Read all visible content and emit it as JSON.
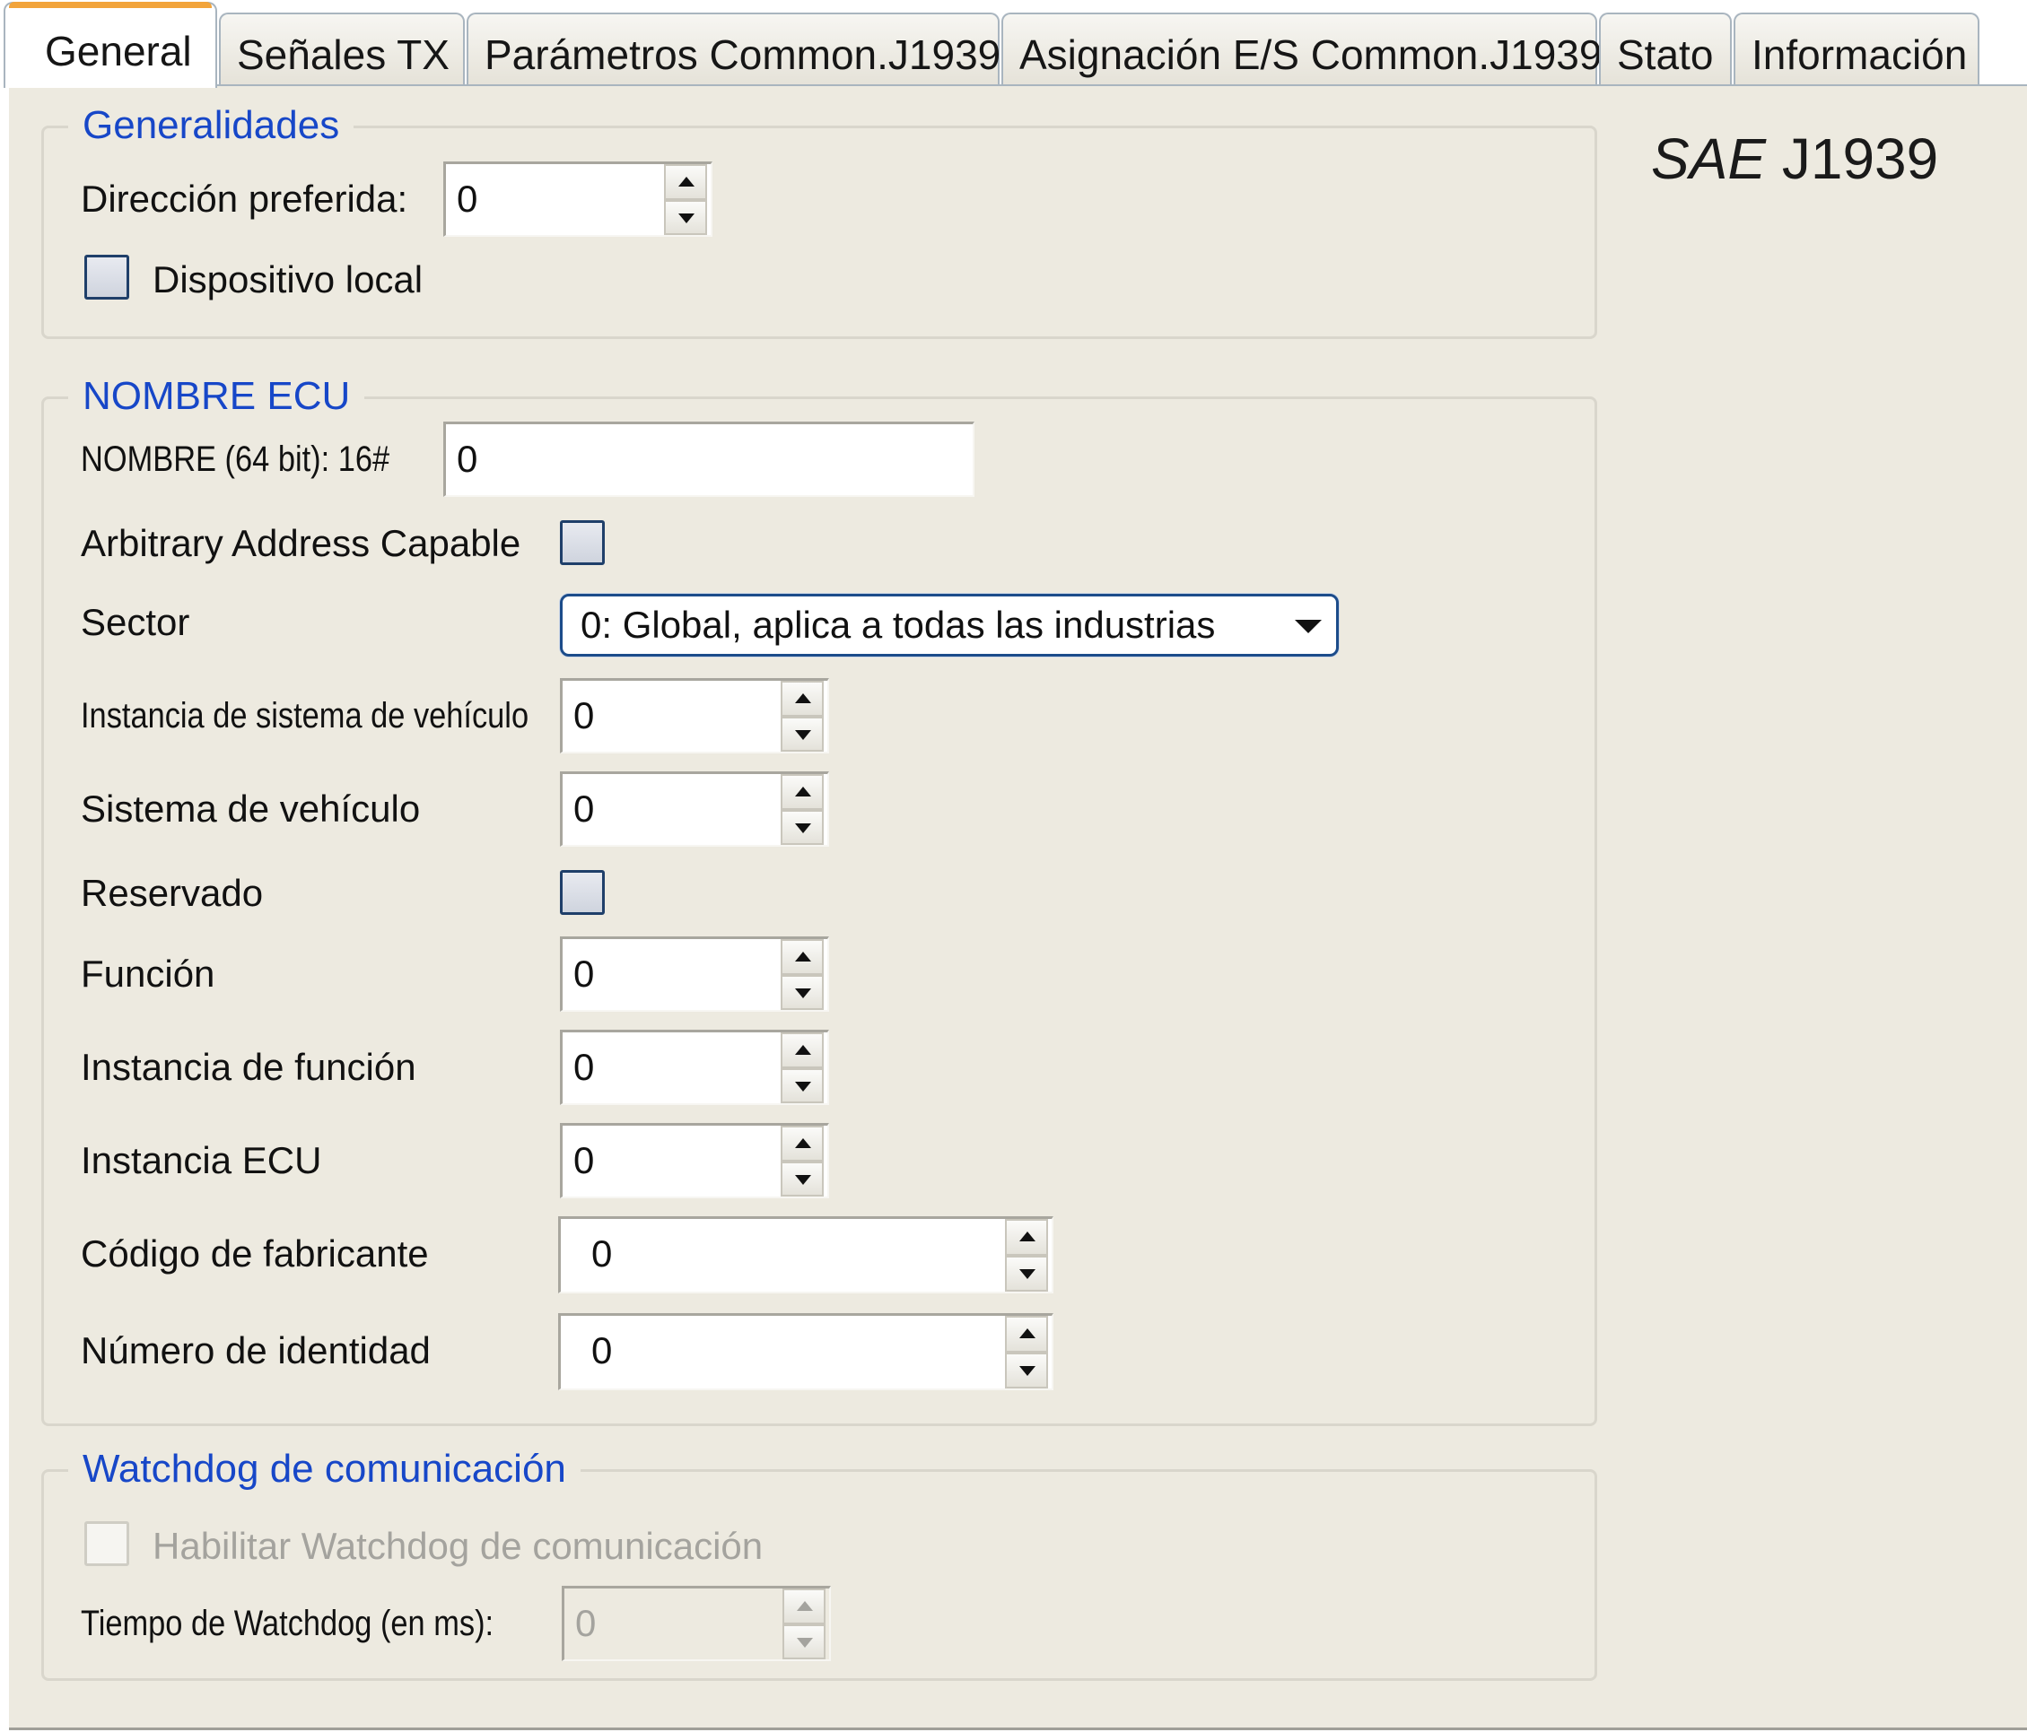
{
  "tabs": [
    {
      "label": "General",
      "active": true
    },
    {
      "label": "Señales TX",
      "active": false
    },
    {
      "label": "Parámetros Common.J1939",
      "active": false
    },
    {
      "label": "Asignación E/S Common.J1939",
      "active": false
    },
    {
      "label": "Stato",
      "active": false
    },
    {
      "label": "Información",
      "active": false
    }
  ],
  "brand": {
    "italic": "SAE",
    "normal": "J1939"
  },
  "generalidades": {
    "legend": "Generalidades",
    "preferred_address_label": "Dirección preferida:",
    "preferred_address_value": "0",
    "local_device_label": "Dispositivo local",
    "local_device_checked": false
  },
  "ecu_name": {
    "legend": "NOMBRE ECU",
    "name_label": "NOMBRE (64 bit): 16#",
    "name_value": "0",
    "arbitrary_label": "Arbitrary Address Capable",
    "arbitrary_checked": false,
    "sector_label": "Sector",
    "sector_value": "0: Global, aplica a todas las industrias",
    "vehicle_instance_label": "Instancia de sistema de vehículo",
    "vehicle_instance_value": "0",
    "vehicle_system_label": "Sistema de vehículo",
    "vehicle_system_value": "0",
    "reserved_label": "Reservado",
    "reserved_checked": false,
    "function_label": "Función",
    "function_value": "0",
    "function_instance_label": "Instancia de función",
    "function_instance_value": "0",
    "ecu_instance_label": "Instancia ECU",
    "ecu_instance_value": "0",
    "manufacturer_label": "Código de fabricante",
    "manufacturer_value": "0",
    "identity_label": "Número de identidad",
    "identity_value": "0"
  },
  "watchdog": {
    "legend": "Watchdog de comunicación",
    "enable_label": "Habilitar Watchdog de comunicación",
    "enable_checked": false,
    "time_label": "Tiempo de Watchdog (en ms):",
    "time_value": "0"
  },
  "colors": {
    "panel_bg": "#edeae0",
    "legend_blue": "#1747c8",
    "active_tab_accent": "#f2a43b",
    "checkbox_border": "#1f3f6a"
  }
}
